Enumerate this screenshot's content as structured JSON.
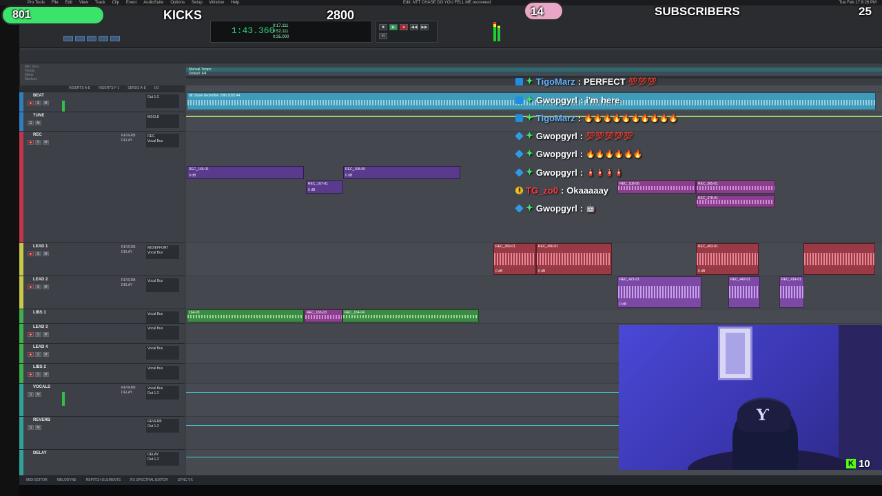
{
  "menubar": {
    "items": [
      "Pro Tools",
      "File",
      "Edit",
      "View",
      "Track",
      "Clip",
      "Event",
      "AudioSuite",
      "Options",
      "Setup",
      "Window",
      "Help"
    ],
    "clock": "Tue Feb 17 8:26 PM"
  },
  "window_title": "Edit: NTT CHASE DO YOU FELL ME.recovered",
  "counter": {
    "main": "1:43.360",
    "start": "0:17.111",
    "end": "0:52.111",
    "length": "0:35.000"
  },
  "transport": [
    "■",
    "▶",
    "●",
    "◀◀",
    "▶▶",
    "⟲"
  ],
  "ruler_labels": {
    "tempo": "Tempo",
    "meter": "Meter",
    "markers": "Markers",
    "min_secs": "Min:Secs"
  },
  "timeline_markers": [
    "Manual Tempo",
    "Default: 4/4"
  ],
  "mixer_headers": [
    "INSERTS A-E",
    "INSERTS F-J",
    "SENDS A-E",
    "I/O"
  ],
  "tracks": [
    {
      "name": "BEAT",
      "color": "#2f7fbf",
      "sends": "",
      "io": "Out 1-2"
    },
    {
      "name": "TUNE",
      "color": "#2f7fbf",
      "sends": "",
      "io": "MSCLE"
    },
    {
      "name": "REC",
      "color": "#c0364a",
      "sends": "REVERB\nDELAY",
      "io": "REC\nVocal Bus"
    },
    {
      "name": "LEAD 1",
      "color": "#c8c84a",
      "sends": "REVERB\nDELAY",
      "io": "MID/EFFORT\nVocal Bus"
    },
    {
      "name": "LEAD 2",
      "color": "#c8c84a",
      "sends": "REVERB\nDELAY",
      "io": "Vocal Bus"
    },
    {
      "name": "LIBS 1",
      "color": "#3fae4e",
      "sends": "",
      "io": "Vocal Bus"
    },
    {
      "name": "LEAD 3",
      "color": "#3fae4e",
      "sends": "",
      "io": "Vocal Bus"
    },
    {
      "name": "LEAD 4",
      "color": "#3fae4e",
      "sends": "",
      "io": "Vocal Bus"
    },
    {
      "name": "LIBS 2",
      "color": "#3fae4e",
      "sends": "",
      "io": "Vocal Bus"
    },
    {
      "name": "VOCALS",
      "color": "#2fa39a",
      "sends": "REVERB\nDELAY",
      "io": "Vocal Bus\nOut 1-2"
    },
    {
      "name": "REVERB",
      "color": "#2fa39a",
      "sends": "",
      "io": "REVERB\nOut 1-2"
    },
    {
      "name": "DELAY",
      "color": "#2fa39a",
      "sends": "",
      "io": "DELAY\nOut 1-2"
    }
  ],
  "clips": {
    "beat": "ntt chase december 20th 2025.44",
    "rec_a": "REC_165-01",
    "rec_b": "REC_167-01",
    "rec_c": "REC_108-05",
    "rec_d": "REC_108-06",
    "rec_e": "REC_365-01",
    "rec_f": "REC_378-01",
    "lead1_a": "REC_369-01",
    "lead1_b": "REC_490-01",
    "lead1_c": "REC_403-01",
    "lead2_a": "REC_421-01",
    "lead2_b": "REC_442-01",
    "lead2_c": "REC_414-01",
    "libs_a": "164-03",
    "libs_b": "REC_165-03",
    "libs_c": "REC_164-04",
    "zero_db": "0 dB"
  },
  "bottom_tabs": [
    "MIDI EDITOR",
    "MELODYNE",
    "REPITCH ELEMENTS",
    "RX SPECTRAL EDITOR",
    "SYNC VX"
  ],
  "overlay": {
    "left_count": "801",
    "kicks_label": "KICKS",
    "kicks_goal": "2800",
    "subs_count": "14",
    "subs_label": "SUBSCRIBERS",
    "subs_goal": "25",
    "kick_viewers": "10",
    "kick_logo": "K"
  },
  "chat": [
    {
      "user": "TigoMarz",
      "user_color": "#6ab4ff",
      "msg": "PERFECT",
      "emotes": "💯💯💯",
      "badge": "sq"
    },
    {
      "user": "Gwopgyrl",
      "user_color": "#ffffff",
      "msg": "i'm here",
      "emotes": "",
      "badge": "sq"
    },
    {
      "user": "TigoMarz",
      "user_color": "#6ab4ff",
      "msg": "",
      "emotes": "🔥🔥🔥🔥🔥🔥🔥🔥🔥🔥",
      "badge": "sq"
    },
    {
      "user": "Gwopgyrl",
      "user_color": "#ffffff",
      "msg": "",
      "emotes": "💯💯💯💯💯",
      "badge": "cube"
    },
    {
      "user": "Gwopgyrl",
      "user_color": "#ffffff",
      "msg": "",
      "emotes": "🔥🔥🔥🔥🔥🔥",
      "badge": "cube"
    },
    {
      "user": "Gwopgyrl",
      "user_color": "#ffffff",
      "msg": "",
      "emotes": "🧯🧯🧯🧯",
      "badge": "cube"
    },
    {
      "user": "TG_zo0",
      "user_color": "#ff3b3b",
      "msg": "Okaaaaay",
      "emotes": "",
      "badge": "warn"
    },
    {
      "user": "Gwopgyrl",
      "user_color": "#ffffff",
      "msg": "",
      "emotes": "🤖",
      "badge": "cube"
    }
  ],
  "colors": {
    "kicks_green": "#3be36a",
    "subs_pink": "#e9a6c6",
    "kick_brand": "#53fc18"
  }
}
